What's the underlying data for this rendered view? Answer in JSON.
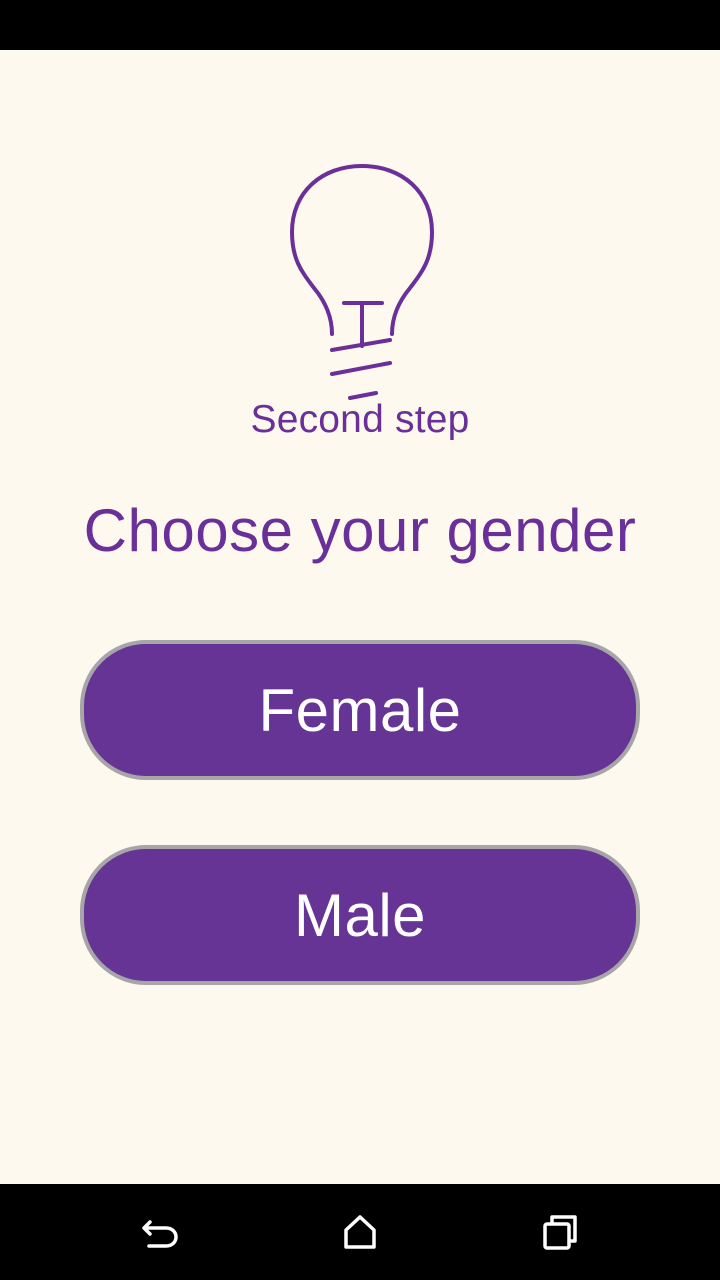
{
  "step": {
    "icon": "lightbulb-icon",
    "label": "Second step"
  },
  "heading": "Choose your gender",
  "options": {
    "female_label": "Female",
    "male_label": "Male"
  },
  "colors": {
    "background": "#fdf9ef",
    "accent": "#6a2f98",
    "button_fill": "#653494",
    "button_border": "#a8a5a8",
    "button_text": "#ffffff"
  },
  "nav": {
    "back_icon": "back-icon",
    "home_icon": "home-icon",
    "recents_icon": "recents-icon"
  }
}
